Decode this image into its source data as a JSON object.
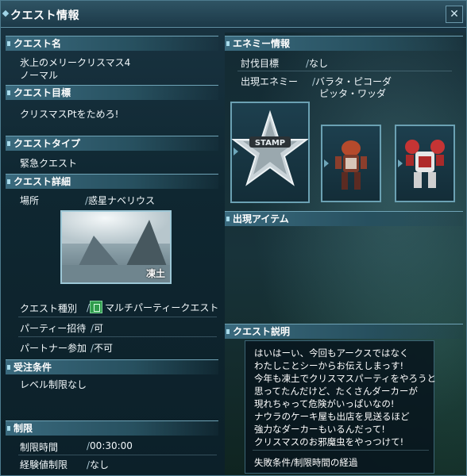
{
  "window": {
    "title": "クエスト情報",
    "close": "✕"
  },
  "left": {
    "quest_name": {
      "header": "クエスト名",
      "name": "氷上のメリークリスマス4",
      "difficulty": "ノーマル"
    },
    "quest_goal": {
      "header": "クエスト目標",
      "value": "クリスマスPtをためろ!"
    },
    "quest_type": {
      "header": "クエストタイプ",
      "value": "緊急クエスト"
    },
    "quest_detail": {
      "header": "クエスト詳細",
      "location_label": "場所",
      "location_value": "惑星ナベリウス",
      "area_label": "凍土",
      "kind_label": "クエスト種別",
      "kind_value": "マルチパーティークエスト",
      "party_invite_label": "パーティー招待",
      "party_invite_value": "可",
      "partner_label": "パートナー参加",
      "partner_value": "不可"
    },
    "requirements": {
      "header": "受注条件",
      "value": "レベル制限なし"
    },
    "limits": {
      "header": "制限",
      "time_label": "制限時間",
      "time_value": "00:30:00",
      "exp_label": "経験値制限",
      "exp_value": "なし"
    }
  },
  "right": {
    "enemy_info": {
      "header": "エネミー情報",
      "target_label": "討伐目標",
      "target_value": "なし",
      "appear_label": "出現エネミー",
      "enemies": [
        "バラタ・ピコーダ",
        "ピッタ・ワッダ"
      ],
      "emblem_text": "STAMP"
    },
    "items": {
      "header": "出現アイテム"
    },
    "description": {
      "header": "クエスト説明",
      "lines": [
        "はいはーい、今回もアークスではなく",
        "わたしことシーからお伝えしまっす!",
        "今年も凍土でクリスマスパーティをやろうと",
        "思ってたんだけど、たくさんダーカーが",
        "現れちゃって危険がいっぱいなの!",
        "ナウラのケーキ屋も出店を見送るほど",
        "強力なダーカーもいるんだって!",
        "クリスマスのお邪魔虫をやっつけて!"
      ],
      "fail_condition": "失敗条件/制限時間の経過"
    }
  },
  "colors": {
    "accent": "#6fa3b6",
    "panel": "#0f2731"
  }
}
